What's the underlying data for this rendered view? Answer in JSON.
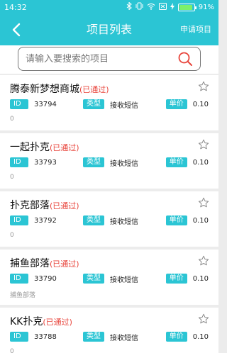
{
  "status_bar": {
    "time": "14:32",
    "battery": "91%",
    "battery_level": 0.91,
    "colors": {
      "bar": "#2bc5d4",
      "battery_fill": "#7cf06b"
    }
  },
  "nav": {
    "title": "项目列表",
    "action_label": "申请项目",
    "back_icon": "chevron-left-icon"
  },
  "search": {
    "placeholder": "请输入要搜索的项目",
    "value": "",
    "icon": "search-icon",
    "icon_color": "#e8453c"
  },
  "labels": {
    "id_tag": "ID",
    "type_tag": "类型",
    "price_tag": "单价"
  },
  "accent_color": "#2bc5d4",
  "status_color": "#e8453c",
  "projects": [
    {
      "name": "腾泰新梦想商城",
      "status": "(已通过)",
      "id": "33794",
      "type": "接收短信",
      "price": "0.10",
      "desc": "0"
    },
    {
      "name": "一起扑克",
      "status": "(已通过)",
      "id": "33793",
      "type": "接收短信",
      "price": "0.10",
      "desc": "0"
    },
    {
      "name": "扑克部落",
      "status": "(已通过)",
      "id": "33792",
      "type": "接收短信",
      "price": "0.10",
      "desc": "0"
    },
    {
      "name": "捕鱼部落",
      "status": "(已通过)",
      "id": "33790",
      "type": "接收短信",
      "price": "0.10",
      "desc": "捕鱼部落"
    },
    {
      "name": "KK扑克",
      "status": "(已通过)",
      "id": "33788",
      "type": "接收短信",
      "price": "0.10",
      "desc": "0"
    }
  ]
}
